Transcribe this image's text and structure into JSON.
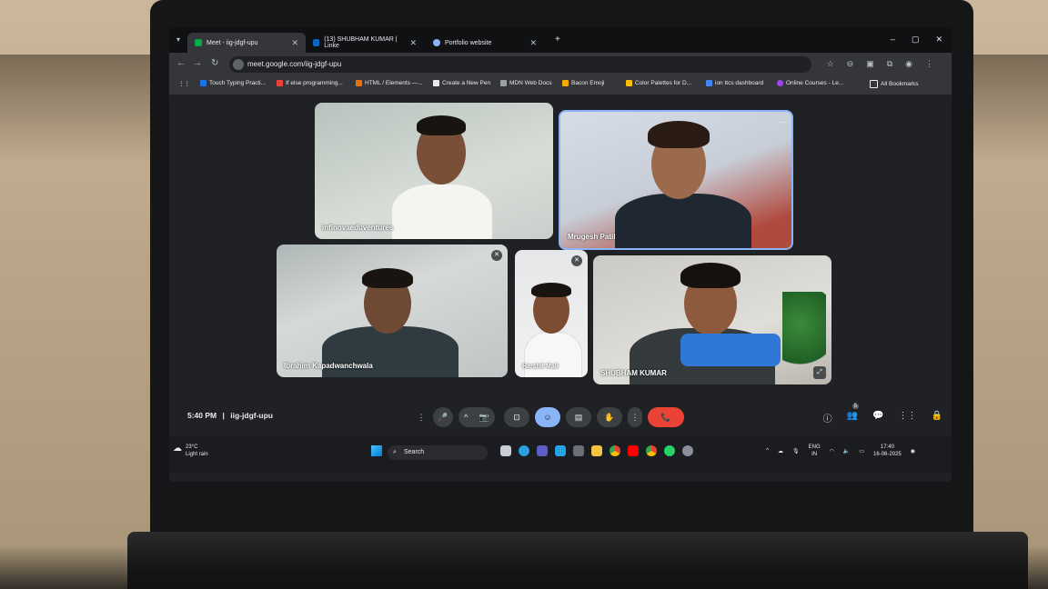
{
  "browser": {
    "tabs": [
      {
        "title": "Meet - iig-jdgf-upu",
        "active": true
      },
      {
        "title": "(13) SHUBHAM KUMAR | Linke",
        "active": false
      },
      {
        "title": "Portfolio website",
        "active": false
      }
    ],
    "new_tab": "+",
    "window_controls": [
      "–",
      "▢",
      "✕"
    ],
    "url": "meet.google.com/iig-jdgf-upu",
    "bookmarks": [
      "Touch Typing Practi...",
      "If else programming...",
      "HTML / Elements —...",
      "Create a New Pen",
      "MDN Web Docs",
      "Bacon Emoji",
      "Color Palettes for D...",
      "ion ttcs dashboard",
      "Online Courses - Le...",
      "All Bookmarks"
    ]
  },
  "meet": {
    "participants": [
      {
        "name": "infinovaeduventures"
      },
      {
        "name": "Mrugesh Patil"
      },
      {
        "name": "Ibrahim Kapadwanchwala"
      },
      {
        "name": "Harshit Mali"
      },
      {
        "name": "SHUBHAM KUMAR"
      }
    ],
    "reactions": [
      "💖",
      "👍",
      "🎉",
      "👏",
      "😂",
      "😮",
      "😢",
      "🤔",
      "👎"
    ],
    "time": "5:40 PM",
    "separator": "|",
    "meeting_code": "iig-jdgf-upu",
    "controls": {
      "more": "⋮",
      "mic": "🎤",
      "expand": "^",
      "camera": "📷",
      "present": "⊡",
      "emoji": "☺",
      "captions": "▤",
      "hand": "✋",
      "options": "⋮",
      "leave": "📞"
    },
    "participant_count": "5",
    "right_icons": [
      "ⓘ",
      "👥",
      "💬",
      "⋮⋮",
      "🔒"
    ]
  },
  "taskbar": {
    "temperature": "23°C",
    "weather": "Light rain",
    "search": "Search",
    "lang_line1": "ENG",
    "lang_line2": "IN",
    "time": "17:40",
    "date": "16-06-2025"
  },
  "colors": {
    "leave": "#ea4335",
    "active_control": "#8ab4f8",
    "surface": "#202124"
  }
}
